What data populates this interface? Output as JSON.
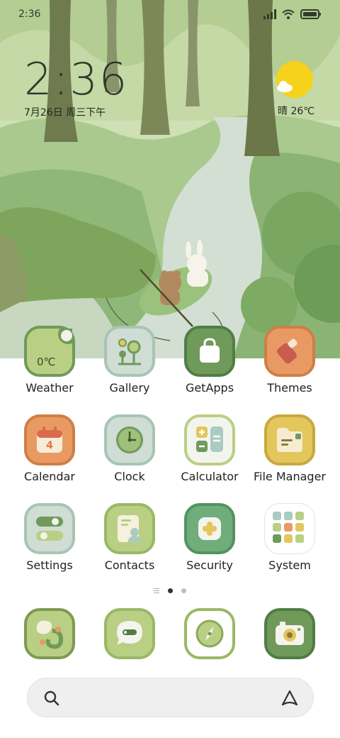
{
  "status_bar": {
    "time": "2:36",
    "icons": [
      "signal-icon",
      "wifi-icon",
      "battery-icon"
    ]
  },
  "clock_widget": {
    "time": "2:36",
    "date": "7月26日 周三下午",
    "weather": "晴 26℃"
  },
  "apps": [
    {
      "label": "Weather",
      "icon": "weather-icon",
      "badge": "0℃"
    },
    {
      "label": "Gallery",
      "icon": "gallery-icon"
    },
    {
      "label": "GetApps",
      "icon": "getapps-icon"
    },
    {
      "label": "Themes",
      "icon": "themes-icon"
    },
    {
      "label": "Calendar",
      "icon": "calendar-icon",
      "badge": "4"
    },
    {
      "label": "Clock",
      "icon": "clock-icon"
    },
    {
      "label": "Calculator",
      "icon": "calculator-icon"
    },
    {
      "label": "File Manager",
      "icon": "file-manager-icon"
    },
    {
      "label": "Settings",
      "icon": "settings-icon"
    },
    {
      "label": "Contacts",
      "icon": "contacts-icon"
    },
    {
      "label": "Security",
      "icon": "security-icon"
    },
    {
      "label": "System",
      "icon": "system-folder-icon"
    }
  ],
  "dock": [
    {
      "icon": "browser-icon"
    },
    {
      "icon": "messages-icon"
    },
    {
      "icon": "compass-icon"
    },
    {
      "icon": "camera-icon"
    }
  ],
  "page_indicator": {
    "pages": 2,
    "active": 1
  },
  "search_bar": {
    "placeholder": ""
  },
  "colors": {
    "green_dark": "#6f9a5a",
    "green_light": "#b9cf84",
    "sage": "#aacbbf",
    "orange": "#e99a62",
    "yellow": "#e3c65c",
    "sun": "#f7d21a"
  }
}
